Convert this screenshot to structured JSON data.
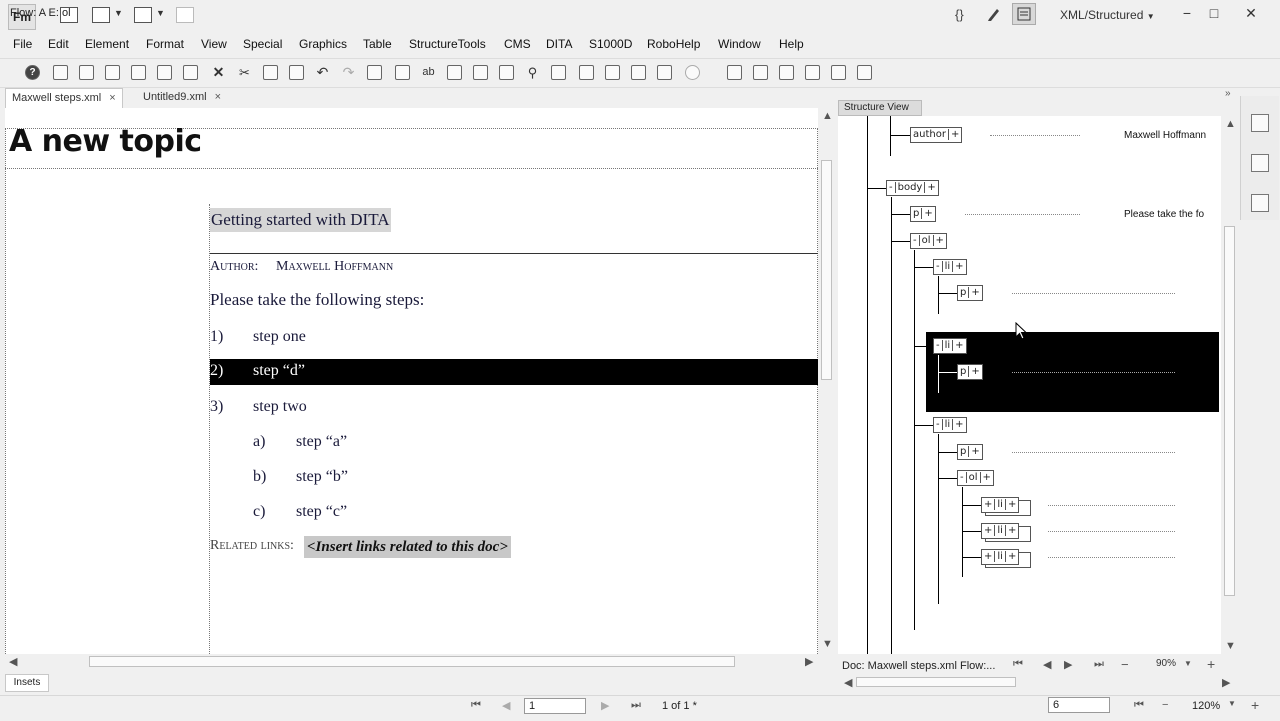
{
  "app": {
    "logo": "Fm",
    "workspace": "XML/Structured",
    "window_buttons": [
      "−",
      "□",
      "✕"
    ],
    "title_icons": [
      "{}",
      "pencil-icon",
      "panel-icon"
    ]
  },
  "menu": [
    "File",
    "Edit",
    "Element",
    "Format",
    "View",
    "Special",
    "Graphics",
    "Table",
    "StructureTools",
    "CMS",
    "DITA",
    "S1000D",
    "RoboHelp",
    "Window",
    "Help"
  ],
  "toolbar": {
    "help_glyph": "?",
    "spell_glyph": "ab"
  },
  "tabs": [
    {
      "label": "Maxwell steps.xml",
      "close": "×",
      "active": true
    },
    {
      "label": "Untitled9.xml",
      "close": "×",
      "active": false
    }
  ],
  "document": {
    "title": "A new topic",
    "shortdesc": "Getting started with DITA",
    "author_label": "Author:",
    "author_name": "Maxwell Hoffmann",
    "paragraph": "Please take the following steps:",
    "steps": [
      {
        "num": "1)",
        "text": "step one",
        "selected": false
      },
      {
        "num": "2)",
        "text": "step “d”",
        "selected": true
      },
      {
        "num": "3)",
        "text": "step two",
        "selected": false
      }
    ],
    "substeps": [
      {
        "num": "a)",
        "text": "step “a”"
      },
      {
        "num": "b)",
        "text": "step “b”"
      },
      {
        "num": "c)",
        "text": "step “c”"
      }
    ],
    "related_label": "Related links:",
    "related_placeholder": "<Insert links related to this doc>"
  },
  "insets_tab": "Insets",
  "status": {
    "flow": "Flow: A  E: ol",
    "page_input": "1",
    "page_count": "1 of 1 *",
    "zoom_input": "6",
    "zoom": "120%"
  },
  "structure_view": {
    "tab": "Structure View",
    "author_text": "Maxwell Hoffmann",
    "p_text": "Please take the fo",
    "status": "Doc: Maxwell steps.xml Flow:...",
    "zoom": "90%",
    "nodes": {
      "minus": "-",
      "plus": "+",
      "author": "author",
      "body": "body",
      "p": "p",
      "ol": "ol",
      "li": "li"
    }
  },
  "colors": {
    "selection": "#000000",
    "shortdesc_bg": "#d6d6d6",
    "placeholder_bg": "#c8c8c8"
  }
}
